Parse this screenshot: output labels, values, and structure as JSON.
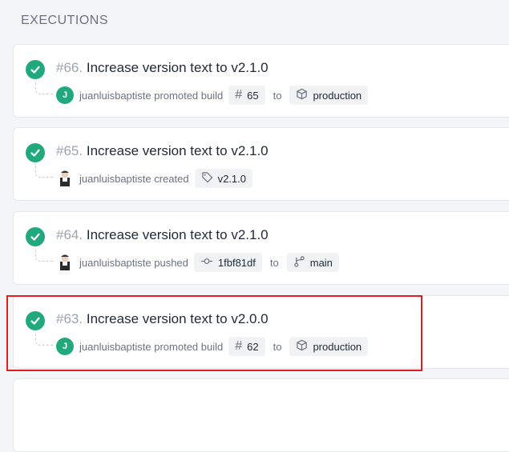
{
  "section_title": "EXECUTIONS",
  "executions": [
    {
      "hash": "#",
      "number": "66.",
      "title": "Increase version text to v2.1.0",
      "avatar": "J",
      "actor_text": "juanluisbaptiste promoted build",
      "build_label": "65",
      "to_label": "to",
      "target_label": "production"
    },
    {
      "hash": "#",
      "number": "65.",
      "title": "Increase version text to v2.1.0",
      "actor_text": "juanluisbaptiste created",
      "tag_label": "v2.1.0"
    },
    {
      "hash": "#",
      "number": "64.",
      "title": "Increase version text to v2.1.0",
      "actor_text": "juanluisbaptiste pushed",
      "commit_label": "1fbf81df",
      "to_label": "to",
      "branch_label": "main"
    },
    {
      "hash": "#",
      "number": "63.",
      "title": "Increase version text to v2.0.0",
      "avatar": "J",
      "actor_text": "juanluisbaptiste promoted build",
      "build_label": "62",
      "to_label": "to",
      "target_label": "production"
    }
  ],
  "colors": {
    "success": "#21a87d",
    "highlight": "#e11d1d"
  },
  "icons": [
    "check-icon",
    "hash-icon",
    "box-icon",
    "tag-icon",
    "commit-icon",
    "branch-icon"
  ]
}
